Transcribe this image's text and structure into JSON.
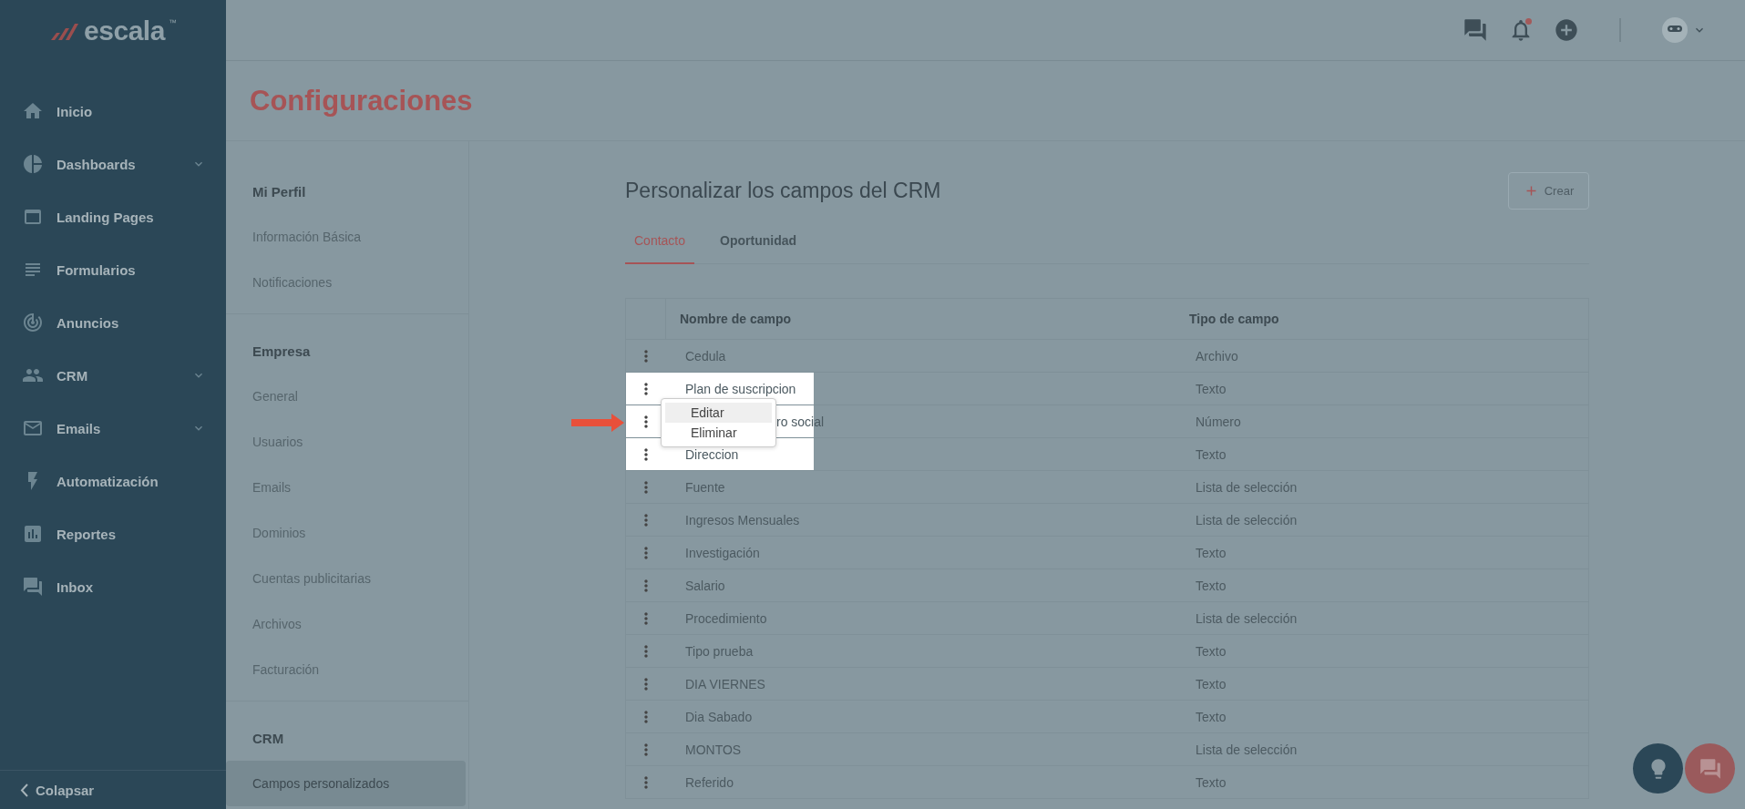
{
  "logo": {
    "text": "escala",
    "mark": "™"
  },
  "sidebar": {
    "items": [
      {
        "label": "Inicio",
        "expandable": false
      },
      {
        "label": "Dashboards",
        "expandable": true
      },
      {
        "label": "Landing Pages",
        "expandable": false
      },
      {
        "label": "Formularios",
        "expandable": false
      },
      {
        "label": "Anuncios",
        "expandable": false
      },
      {
        "label": "CRM",
        "expandable": true
      },
      {
        "label": "Emails",
        "expandable": true
      },
      {
        "label": "Automatización",
        "expandable": false
      },
      {
        "label": "Reportes",
        "expandable": false
      },
      {
        "label": "Inbox",
        "expandable": false
      }
    ],
    "collapse": "Colapsar"
  },
  "topbar": {
    "notifications_unread": true
  },
  "page_title": "Configuraciones",
  "settings_nav": {
    "sections": [
      {
        "title": "Mi Perfil",
        "items": [
          {
            "label": "Información Básica",
            "selected": false
          },
          {
            "label": "Notificaciones",
            "selected": false
          }
        ]
      },
      {
        "title": "Empresa",
        "items": [
          {
            "label": "General",
            "selected": false
          },
          {
            "label": "Usuarios",
            "selected": false
          },
          {
            "label": "Emails",
            "selected": false
          },
          {
            "label": "Dominios",
            "selected": false
          },
          {
            "label": "Cuentas publicitarias",
            "selected": false
          },
          {
            "label": "Archivos",
            "selected": false
          },
          {
            "label": "Facturación",
            "selected": false
          }
        ]
      },
      {
        "title": "CRM",
        "items": [
          {
            "label": "Campos personalizados",
            "selected": true
          }
        ]
      }
    ]
  },
  "content": {
    "title": "Personalizar los campos del CRM",
    "create_button": "Crear",
    "tabs": [
      {
        "label": "Contacto",
        "selected": true
      },
      {
        "label": "Oportunidad",
        "selected": false
      }
    ],
    "table": {
      "columns": [
        "Nombre de campo",
        "Tipo de campo"
      ],
      "rows": [
        {
          "name": "Cedula",
          "type": "Archivo",
          "highlighted": false,
          "menu_open": false
        },
        {
          "name": "Plan de suscripcion",
          "type": "Texto",
          "highlighted": true,
          "menu_open": false
        },
        {
          "name": "ro social",
          "type": "Número",
          "highlighted": true,
          "menu_open": true
        },
        {
          "name": "Direccion",
          "type": "Texto",
          "highlighted": true,
          "menu_open": false
        },
        {
          "name": "Fuente",
          "type": "Lista de selección",
          "highlighted": false,
          "menu_open": false
        },
        {
          "name": "Ingresos Mensuales",
          "type": "Lista de selección",
          "highlighted": false,
          "menu_open": false
        },
        {
          "name": "Investigación",
          "type": "Texto",
          "highlighted": false,
          "menu_open": false
        },
        {
          "name": "Salario",
          "type": "Texto",
          "highlighted": false,
          "menu_open": false
        },
        {
          "name": "Procedimiento",
          "type": "Lista de selección",
          "highlighted": false,
          "menu_open": false
        },
        {
          "name": "Tipo prueba",
          "type": "Texto",
          "highlighted": false,
          "menu_open": false
        },
        {
          "name": "DIA VIERNES",
          "type": "Texto",
          "highlighted": false,
          "menu_open": false
        },
        {
          "name": "Dia Sabado",
          "type": "Texto",
          "highlighted": false,
          "menu_open": false
        },
        {
          "name": "MONTOS",
          "type": "Lista de selección",
          "highlighted": false,
          "menu_open": false
        },
        {
          "name": "Referido",
          "type": "Texto",
          "highlighted": false,
          "menu_open": false
        }
      ]
    },
    "row_menu": {
      "items": [
        {
          "label": "Editar",
          "selected": true
        },
        {
          "label": "Eliminar",
          "selected": false
        }
      ]
    }
  }
}
